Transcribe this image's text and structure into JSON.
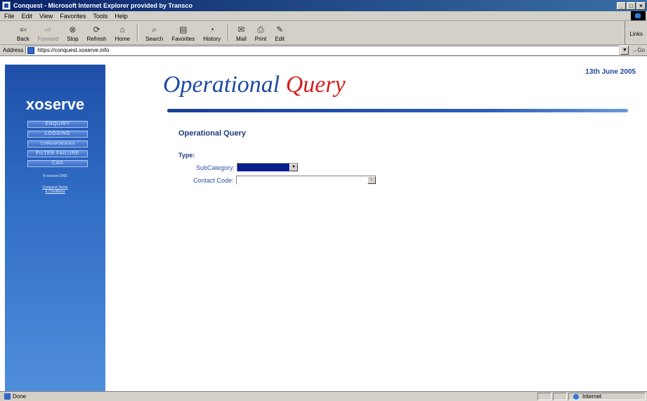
{
  "window": {
    "title": "Conquest - Microsoft Internet Explorer provided by Transco",
    "buttons": [
      "_",
      "□",
      "×"
    ]
  },
  "menu": [
    "File",
    "Edit",
    "View",
    "Favorites",
    "Tools",
    "Help"
  ],
  "toolbar": {
    "back": "Back",
    "forward": "Forward",
    "stop": "Stop",
    "refresh": "Refresh",
    "home": "Home",
    "search": "Search",
    "favorites": "Favorites",
    "history": "History",
    "mail": "Mail",
    "print": "Print",
    "edit": "Edit",
    "links": "Links"
  },
  "address": {
    "label": "Address",
    "url": "https://conquest.xoserve.info",
    "go": "Go"
  },
  "sidebar": {
    "logo": "xoserve",
    "nav": [
      "ENQUIRY",
      "LOGGING",
      "CORRESPONDENCE",
      "FILTER FAILURE",
      "CAD"
    ],
    "copyright": "© xoserve 2005",
    "terms": [
      "Conquest Terms",
      "& Conditions"
    ]
  },
  "page": {
    "date": "13th June 2005",
    "banner_left": "Operational",
    "banner_right": "Query",
    "subheading": "Operational Query",
    "type_label": "Type:",
    "subcategory_label": "SubCategory:",
    "contact_code_label": "Contact Code:"
  },
  "status": {
    "text": "Done",
    "zone": "Internet"
  },
  "colors": {
    "sidebar_top": "#1f4fa8",
    "heading_blue": "#1f4aa0",
    "heading_red": "#d22020",
    "selected_fill": "#0a1f8f"
  }
}
